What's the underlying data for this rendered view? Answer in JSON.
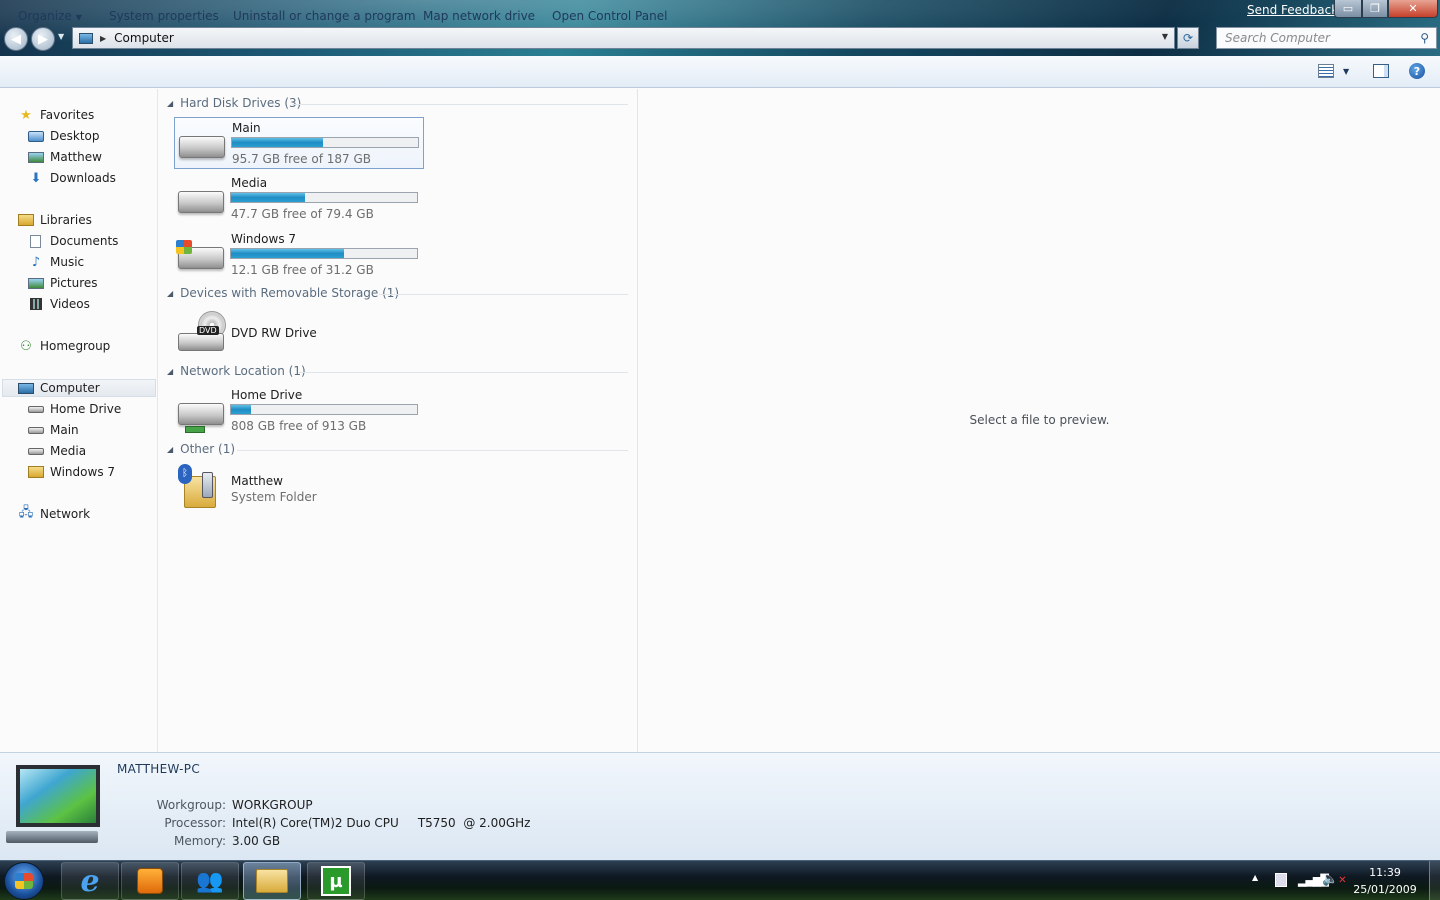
{
  "window": {
    "send_feedback": "Send Feedback",
    "caption_buttons": {
      "minimize": "▭",
      "maximize": "❐",
      "close": "✕"
    }
  },
  "address": {
    "location": "Computer",
    "search_placeholder": "Search Computer"
  },
  "toolbar": {
    "organize": "Organize",
    "system_properties": "System properties",
    "uninstall": "Uninstall or change a program",
    "map_drive": "Map network drive",
    "control_panel": "Open Control Panel"
  },
  "nav": {
    "favorites": {
      "label": "Favorites",
      "items": [
        "Desktop",
        "Matthew",
        "Downloads"
      ]
    },
    "libraries": {
      "label": "Libraries",
      "items": [
        "Documents",
        "Music",
        "Pictures",
        "Videos"
      ]
    },
    "homegroup": "Homegroup",
    "computer": {
      "label": "Computer",
      "items": [
        "Home Drive",
        "Main",
        "Media",
        "Windows 7"
      ]
    },
    "network": "Network"
  },
  "groups": {
    "hard_disks": "Hard Disk Drives (3)",
    "removable": "Devices with Removable Storage (1)",
    "network_location": "Network Location (1)",
    "other": "Other (1)"
  },
  "drives": [
    {
      "name": "Main",
      "free_text": "95.7 GB free of 187 GB",
      "used_fraction": 0.49
    },
    {
      "name": "Media",
      "free_text": "47.7 GB free of 79.4 GB",
      "used_fraction": 0.4
    },
    {
      "name": "Windows 7",
      "free_text": "12.1 GB free of 31.2 GB",
      "used_fraction": 0.61
    },
    {
      "name": "Home Drive",
      "free_text": "808 GB free of 913 GB",
      "used_fraction": 0.11
    }
  ],
  "dvd": {
    "name": "DVD RW Drive",
    "badge": "DVD"
  },
  "other_item": {
    "name": "Matthew",
    "type": "System Folder"
  },
  "preview": {
    "message": "Select a file to preview."
  },
  "details": {
    "pc_name": "MATTHEW-PC",
    "workgroup_label": "Workgroup:",
    "workgroup": "WORKGROUP",
    "processor_label": "Processor:",
    "processor": "Intel(R) Core(TM)2 Duo CPU     T5750  @ 2.00GHz",
    "memory_label": "Memory:",
    "memory": "3.00 GB"
  },
  "taskbar": {
    "ie_glyph": "e",
    "utorrent_glyph": "µ",
    "time": "11:39",
    "date": "25/01/2009"
  },
  "colors": {
    "drive_fill": "#1f8dc4",
    "selection_border": "#7da2ce",
    "link_text": "#1e395b"
  }
}
